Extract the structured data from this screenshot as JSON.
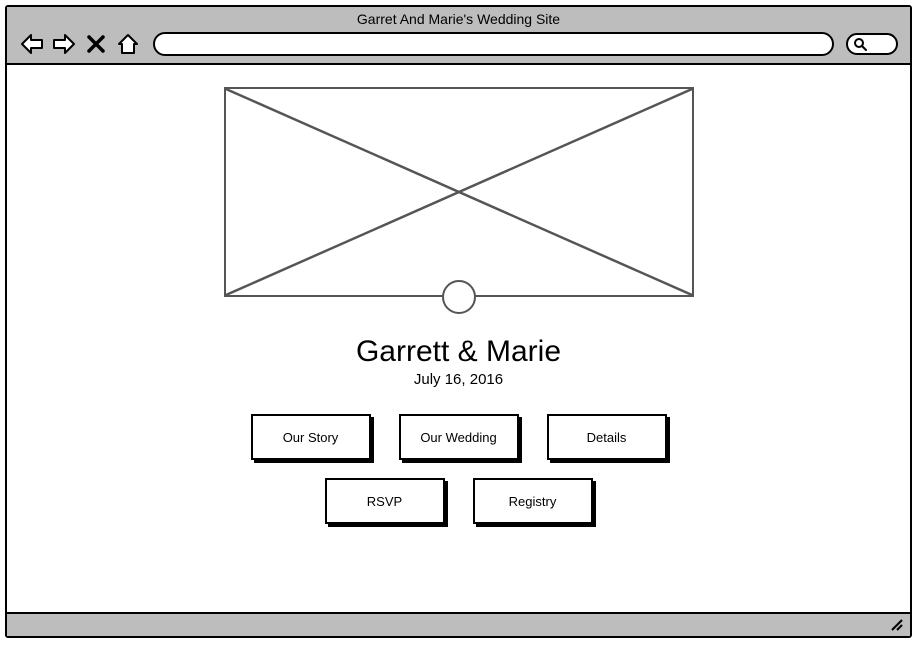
{
  "browser": {
    "title": "Garret And Marie's Wedding Site"
  },
  "page": {
    "heading": "Garrett & Marie",
    "date": "July 16, 2016"
  },
  "nav": {
    "row1": [
      {
        "label": "Our Story"
      },
      {
        "label": "Our Wedding"
      },
      {
        "label": "Details"
      }
    ],
    "row2": [
      {
        "label": "RSVP"
      },
      {
        "label": "Registry"
      }
    ]
  }
}
